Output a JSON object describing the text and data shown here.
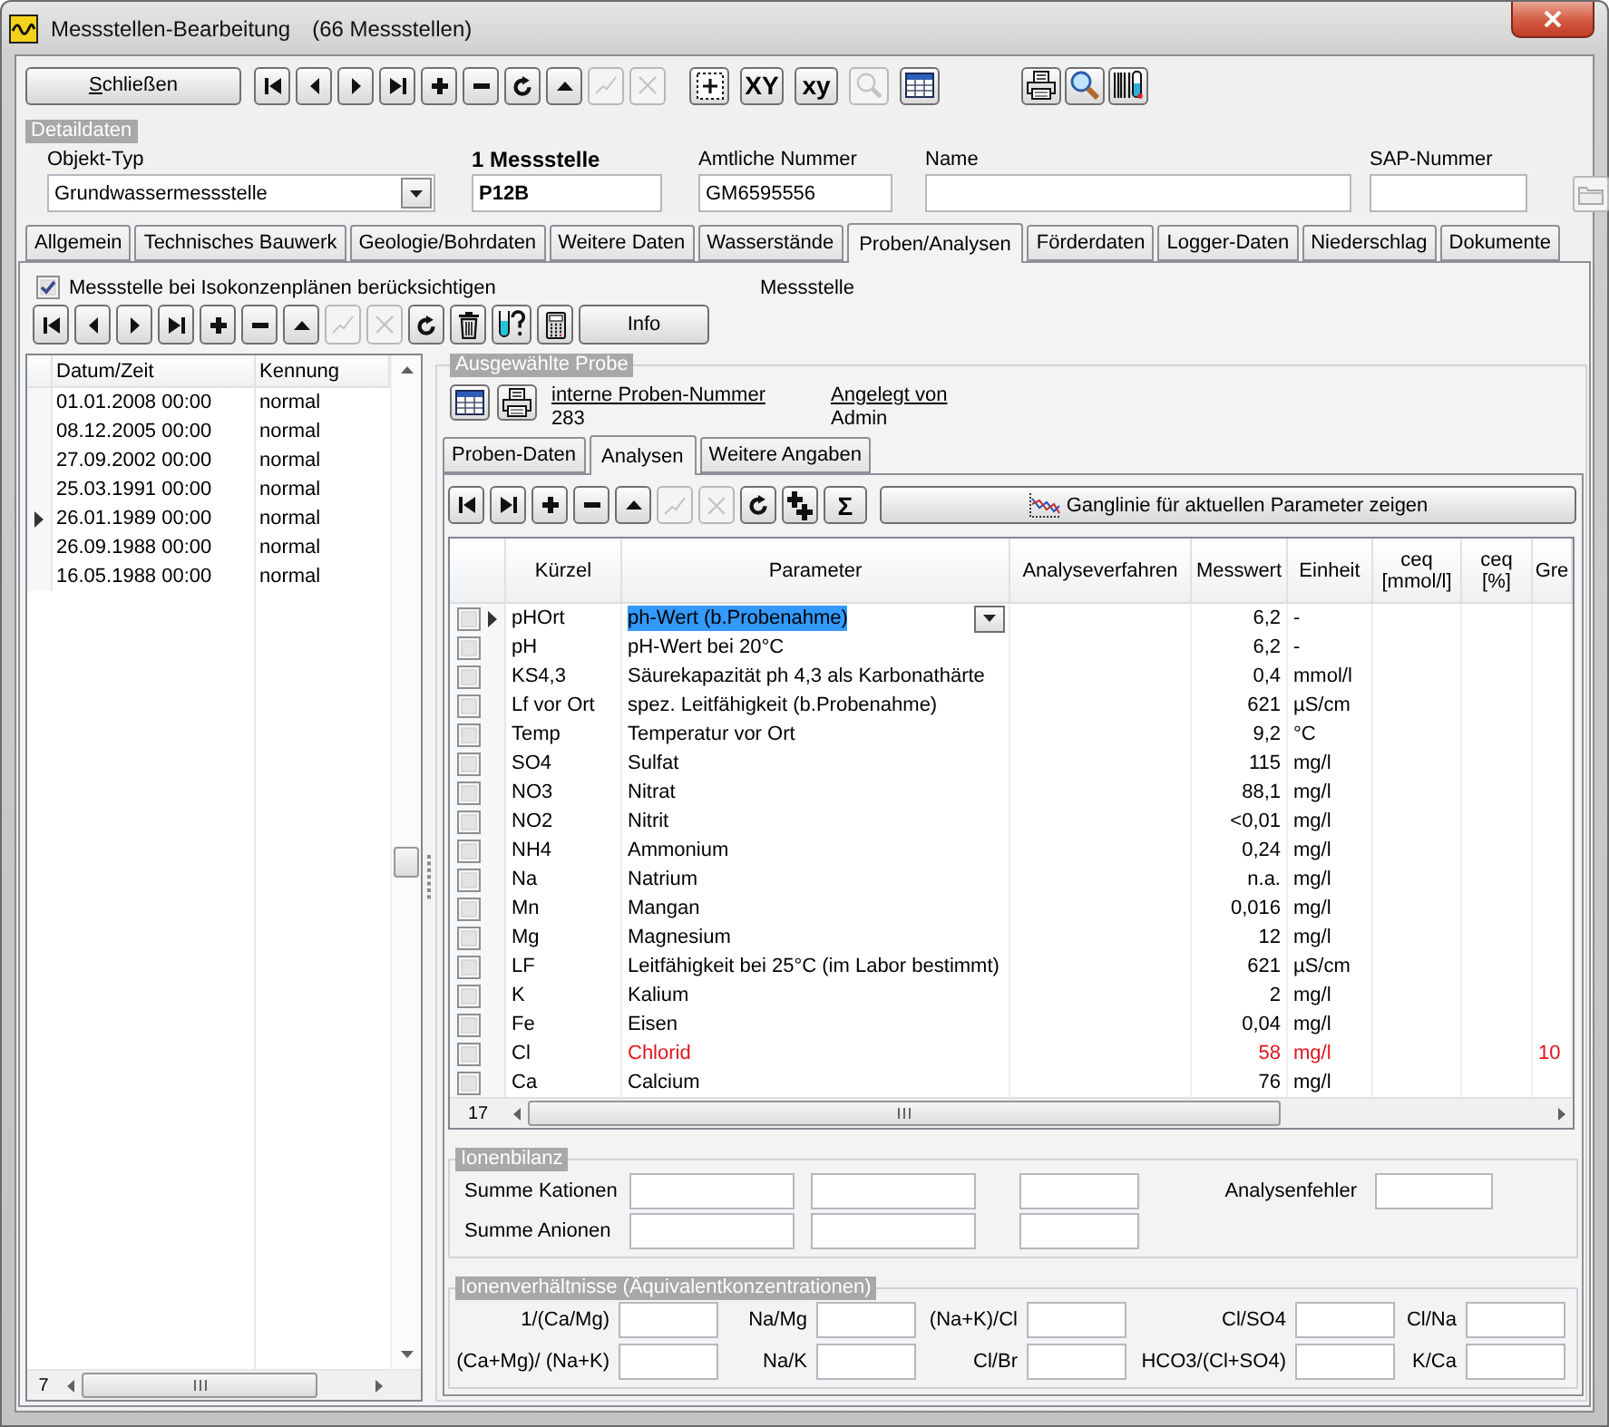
{
  "window": {
    "title": "Messstellen-Bearbeitung",
    "subtitle": "(66 Messstellen)"
  },
  "toolbar": {
    "close_button": "Schließen",
    "groups": [
      [
        {
          "kind": "first",
          "disabled": false
        },
        {
          "kind": "prev",
          "disabled": false
        },
        {
          "kind": "next",
          "disabled": false
        },
        {
          "kind": "last",
          "disabled": false
        },
        {
          "kind": "add",
          "disabled": false
        },
        {
          "kind": "remove",
          "disabled": false
        },
        {
          "kind": "refresh",
          "disabled": false
        },
        {
          "kind": "up",
          "disabled": false
        },
        {
          "kind": "confirm",
          "disabled": true
        },
        {
          "kind": "cancel",
          "disabled": true
        }
      ],
      [
        {
          "kind": "frame_add",
          "disabled": false
        },
        {
          "kind": "text",
          "label": "XY",
          "disabled": false
        },
        {
          "kind": "text",
          "label": "xy",
          "disabled": false
        },
        {
          "kind": "search",
          "disabled": true
        },
        {
          "kind": "table",
          "disabled": false
        }
      ],
      [
        {
          "kind": "print",
          "disabled": false
        },
        {
          "kind": "zoom",
          "disabled": false
        },
        {
          "kind": "barcode",
          "disabled": false
        }
      ]
    ]
  },
  "detail": {
    "title": "Detaildaten",
    "fields": [
      {
        "kind": "combo",
        "label": "Objekt-Typ",
        "value": "Grundwassermessstelle"
      },
      {
        "kind": "key",
        "label": "1 Messstelle",
        "value": "P12B"
      },
      {
        "kind": "text",
        "label": "Amtliche Nummer",
        "value": "GM6595556"
      },
      {
        "kind": "text",
        "label": "Name"
      },
      {
        "kind": "text",
        "label": "SAP-Nummer"
      }
    ]
  },
  "tabs": [
    {
      "label": "Allgemein",
      "selected": false
    },
    {
      "label": "Technisches Bauwerk",
      "selected": false
    },
    {
      "label": "Geologie/Bohrdaten",
      "selected": false
    },
    {
      "label": "Weitere Daten",
      "selected": false
    },
    {
      "label": "Wasserstände",
      "selected": false
    },
    {
      "label": "Proben/Analysen",
      "selected": true
    },
    {
      "label": "Förderdaten",
      "selected": false
    },
    {
      "label": "Logger-Daten",
      "selected": false
    },
    {
      "label": "Niederschlag",
      "selected": false
    },
    {
      "label": "Dokumente",
      "selected": false
    }
  ],
  "measuring_point": {
    "checkbox": {
      "label": "Messstelle bei Isokonzenplänen berücksichtigen",
      "checked": true
    },
    "caption": "Messstelle",
    "toolbar": [
      {
        "kind": "first",
        "disabled": false
      },
      {
        "kind": "prev",
        "disabled": false
      },
      {
        "kind": "next",
        "disabled": false
      },
      {
        "kind": "last",
        "disabled": false
      },
      {
        "kind": "add",
        "disabled": false
      },
      {
        "kind": "remove",
        "disabled": false
      },
      {
        "kind": "up",
        "disabled": false
      },
      {
        "kind": "confirm",
        "disabled": true
      },
      {
        "kind": "cancel",
        "disabled": true
      },
      {
        "kind": "refresh",
        "disabled": false
      },
      {
        "kind": "trash",
        "disabled": false
      },
      {
        "kind": "tube_query",
        "disabled": false
      },
      {
        "kind": "calculator",
        "disabled": false
      },
      {
        "kind": "wide",
        "label": "Info",
        "disabled": false
      }
    ]
  },
  "samples": {
    "columns": [
      "Datum/Zeit",
      "Kennung"
    ],
    "rows": [
      {
        "date": "01.01.2008 00:00",
        "status": "normal",
        "selected": false
      },
      {
        "date": "08.12.2005 00:00",
        "status": "normal",
        "selected": false
      },
      {
        "date": "27.09.2002 00:00",
        "status": "normal",
        "selected": false
      },
      {
        "date": "25.03.1991 00:00",
        "status": "normal",
        "selected": false
      },
      {
        "date": "26.01.1989 00:00",
        "status": "normal",
        "selected": true
      },
      {
        "date": "26.09.1988 00:00",
        "status": "normal",
        "selected": false
      },
      {
        "date": "16.05.1988 00:00",
        "status": "normal",
        "selected": false
      }
    ],
    "count": "7"
  },
  "sample": {
    "title": "Ausgewählte Probe",
    "buttons": [
      {
        "kind": "table"
      },
      {
        "kind": "print"
      }
    ],
    "info": [
      {
        "label": "interne Proben-Nummer",
        "value": "283"
      },
      {
        "label": "Angelegt von",
        "value": "Admin"
      }
    ],
    "tabs": [
      {
        "label": "Proben-Daten",
        "selected": false
      },
      {
        "label": "Analysen",
        "selected": true
      },
      {
        "label": "Weitere Angaben",
        "selected": false
      }
    ],
    "toolbar": [
      {
        "kind": "first",
        "disabled": false
      },
      {
        "kind": "last",
        "disabled": false
      },
      {
        "kind": "add",
        "disabled": false
      },
      {
        "kind": "remove",
        "disabled": false
      },
      {
        "kind": "up",
        "disabled": false
      },
      {
        "kind": "confirm",
        "disabled": true
      },
      {
        "kind": "cancel",
        "disabled": true
      },
      {
        "kind": "refresh",
        "disabled": false
      },
      {
        "kind": "stack_add",
        "disabled": false
      },
      {
        "kind": "text",
        "label": "Σ",
        "disabled": false
      }
    ],
    "chart_button": "Ganglinie für aktuellen Parameter zeigen",
    "table": {
      "columns": [
        "Kürzel",
        "Parameter",
        "Analyseverfahren",
        "Messwert",
        "Einheit",
        "ceq [mmol/l]",
        "ceq [%]",
        "Gre"
      ],
      "rows": [
        {
          "checked": false,
          "selected": true,
          "editing": true,
          "exceeded": false,
          "code": "pHOrt",
          "parameter": "ph-Wert (b.Probenahme)",
          "value": "6,2",
          "unit": "-"
        },
        {
          "checked": false,
          "selected": false,
          "editing": false,
          "exceeded": false,
          "code": "pH",
          "parameter": "pH-Wert bei 20°C",
          "value": "6,2",
          "unit": "-"
        },
        {
          "checked": false,
          "selected": false,
          "editing": false,
          "exceeded": false,
          "code": "KS4,3",
          "parameter": "Säurekapazität ph 4,3 als Karbonathärte",
          "value": "0,4",
          "unit": "mmol/l"
        },
        {
          "checked": false,
          "selected": false,
          "editing": false,
          "exceeded": false,
          "code": "Lf vor Ort",
          "parameter": "spez. Leitfähigkeit (b.Probenahme)",
          "value": "621",
          "unit": "µS/cm"
        },
        {
          "checked": false,
          "selected": false,
          "editing": false,
          "exceeded": false,
          "code": "Temp",
          "parameter": "Temperatur vor Ort",
          "value": "9,2",
          "unit": "°C"
        },
        {
          "checked": false,
          "selected": false,
          "editing": false,
          "exceeded": false,
          "code": "SO4",
          "parameter": "Sulfat",
          "value": "115",
          "unit": "mg/l"
        },
        {
          "checked": false,
          "selected": false,
          "editing": false,
          "exceeded": false,
          "code": "NO3",
          "parameter": "Nitrat",
          "value": "88,1",
          "unit": "mg/l"
        },
        {
          "checked": false,
          "selected": false,
          "editing": false,
          "exceeded": false,
          "code": "NO2",
          "parameter": "Nitrit",
          "value": "<0,01",
          "unit": "mg/l"
        },
        {
          "checked": false,
          "selected": false,
          "editing": false,
          "exceeded": false,
          "code": "NH4",
          "parameter": "Ammonium",
          "value": "0,24",
          "unit": "mg/l"
        },
        {
          "checked": false,
          "selected": false,
          "editing": false,
          "exceeded": false,
          "code": "Na",
          "parameter": "Natrium",
          "value": "n.a.",
          "unit": "mg/l"
        },
        {
          "checked": false,
          "selected": false,
          "editing": false,
          "exceeded": false,
          "code": "Mn",
          "parameter": "Mangan",
          "value": "0,016",
          "unit": "mg/l"
        },
        {
          "checked": false,
          "selected": false,
          "editing": false,
          "exceeded": false,
          "code": "Mg",
          "parameter": "Magnesium",
          "value": "12",
          "unit": "mg/l"
        },
        {
          "checked": false,
          "selected": false,
          "editing": false,
          "exceeded": false,
          "code": "LF",
          "parameter": "Leitfähigkeit bei 25°C (im Labor bestimmt)",
          "value": "621",
          "unit": "µS/cm"
        },
        {
          "checked": false,
          "selected": false,
          "editing": false,
          "exceeded": false,
          "code": "K",
          "parameter": "Kalium",
          "value": "2",
          "unit": "mg/l"
        },
        {
          "checked": false,
          "selected": false,
          "editing": false,
          "exceeded": false,
          "code": "Fe",
          "parameter": "Eisen",
          "value": "0,04",
          "unit": "mg/l"
        },
        {
          "checked": false,
          "selected": false,
          "editing": false,
          "exceeded": true,
          "code": "Cl",
          "parameter": "Chlorid",
          "value": "58",
          "unit": "mg/l",
          "limit": "10"
        },
        {
          "checked": false,
          "selected": false,
          "editing": false,
          "exceeded": false,
          "code": "Ca",
          "parameter": "Calcium",
          "value": "76",
          "unit": "mg/l"
        }
      ],
      "count": "17"
    },
    "ion_balance": {
      "title": "Ionenbilanz",
      "rows": [
        "Summe Kationen",
        "Summe Anionen"
      ],
      "error_label": "Analysenfehler"
    },
    "ion_ratios": {
      "title": "Ionenverhältnisse (Äquivalentkonzentrationen)",
      "rows": [
        [
          "1/(Ca/Mg)",
          "Na/Mg",
          "(Na+K)/Cl",
          "Cl/SO4",
          "Cl/Na"
        ],
        [
          "(Ca+Mg)/ (Na+K)",
          "Na/K",
          "Cl/Br",
          "HCO3/(Cl+SO4)",
          "K/Ca"
        ]
      ]
    }
  }
}
